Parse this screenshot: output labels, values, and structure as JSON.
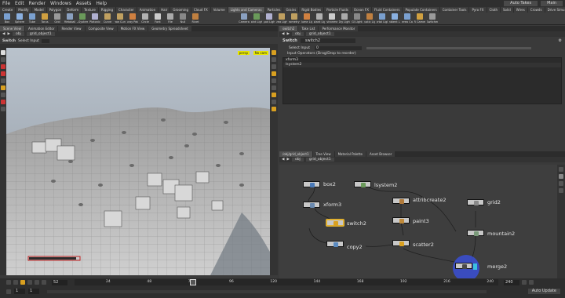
{
  "menu": [
    "File",
    "Edit",
    "Render",
    "Windows",
    "Assets",
    "Help"
  ],
  "desktop": {
    "auto_takes": "Auto Takes",
    "main": "Main"
  },
  "shelf_tabs": [
    "Create",
    "Modify",
    "Model",
    "Polygon",
    "Deform",
    "Texture",
    "Rigging",
    "Character",
    "Animation",
    "Hair",
    "Grooming",
    "Cloud FX",
    "Volume",
    "Lights and Cameras",
    "Particles",
    "Grains",
    "Rigid Bodies",
    "Particle Fluids",
    "Ocean FX",
    "Fluid Containers",
    "Populate Containers",
    "Container Tools",
    "Pyro FX",
    "Cloth",
    "Solid",
    "Wires",
    "Crowds",
    "Drive Simulation"
  ],
  "shelf_tools_left": [
    "Box",
    "Sphere",
    "Tube",
    "Torus",
    "Grid",
    "Metaball",
    "L-System",
    "Platonic",
    "Curve",
    "Draw Curve",
    "Spray Paint",
    "Circle",
    "Font",
    "File",
    "Null",
    "Rivet"
  ],
  "shelf_tools_right": [
    "Camera",
    "Point Light",
    "Spot Light",
    "Area Light",
    "Geometry L.",
    "Volume Light",
    "Distant Light",
    "Environment",
    "Sky Light",
    "GI Light",
    "Caustic Light",
    "Portal Light",
    "Ambient Lig.",
    "Stereo Cam",
    "VR Camera",
    "Switcher"
  ],
  "left_tabs": [
    "Scene View",
    "Animation Editor",
    "Render View",
    "Composite View",
    "Motion FX View",
    "Geometry Spreadsheet"
  ],
  "left_path": {
    "root": "obj",
    "node": "grid_object1"
  },
  "viewport_header": {
    "op": "Switch",
    "select": "Select Input"
  },
  "viewport_badges": {
    "persp": "persp",
    "cam": "No cam"
  },
  "right_tabs": [
    "switch2",
    "Take List",
    "Performance Monitor"
  ],
  "right_path": {
    "root": "obj",
    "node": "grid_object1"
  },
  "parm": {
    "op": "Switch",
    "name": "switch2",
    "select_label": "Select Input",
    "select_value": "0",
    "inputs_label": "Input Operators (Drag/Drop to reorder)",
    "inputs": [
      "xform3",
      "lsystem2"
    ]
  },
  "net_tabs": [
    "/obj/grid_object1",
    "Tree View",
    "Material Palette",
    "Asset Browser"
  ],
  "net_path": {
    "root": "obj",
    "node": "grid_object1"
  },
  "nodes": {
    "box2": "box2",
    "lsystem2": "lsystem2",
    "xform3": "xform3",
    "attribcreate2": "attribcreate2",
    "grid2": "grid2",
    "paint3": "paint3",
    "switch2": "switch2",
    "mountain2": "mountain2",
    "copy2": "copy2",
    "scatter2": "scatter2",
    "merge2": "merge2"
  },
  "timeline": {
    "current_frame": "52",
    "start": "1",
    "end": "1",
    "end_frame": "240",
    "ticks": [
      "24",
      "48",
      "72",
      "96",
      "120",
      "144",
      "168",
      "192",
      "216",
      "240"
    ],
    "auto_update": "Auto Update"
  },
  "colors": {
    "accent": "#e0b030",
    "bg": "#3a3a3a"
  }
}
